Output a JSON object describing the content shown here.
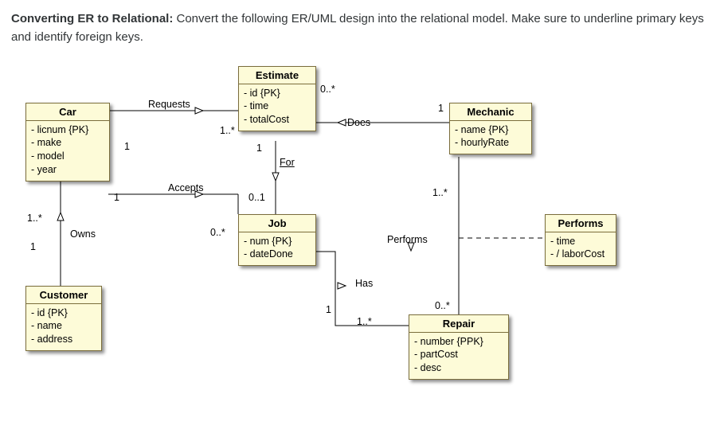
{
  "intro": {
    "lead": "Converting ER to Relational:",
    "rest": " Convert the following ER/UML design into the relational model. Make sure to underline primary keys and identify foreign keys."
  },
  "entities": {
    "car": {
      "title": "Car",
      "attrs": [
        "- licnum {PK}",
        "- make",
        "- model",
        "- year"
      ]
    },
    "estimate": {
      "title": "Estimate",
      "attrs": [
        "- id {PK}",
        "- time",
        "- totalCost"
      ]
    },
    "mechanic": {
      "title": "Mechanic",
      "attrs": [
        "- name {PK}",
        "- hourlyRate"
      ]
    },
    "job": {
      "title": "Job",
      "attrs": [
        "- num {PK}",
        "- dateDone"
      ]
    },
    "customer": {
      "title": "Customer",
      "attrs": [
        "- id {PK}",
        "- name",
        "- address"
      ]
    },
    "repair": {
      "title": "Repair",
      "attrs": [
        "- number {PPK}",
        "- partCost",
        "- desc"
      ]
    },
    "performs": {
      "title": "Performs",
      "attrs": [
        "- time",
        "- / laborCost"
      ]
    }
  },
  "labels": {
    "requests": "Requests",
    "does": "Does",
    "accepts": "Accepts",
    "for": "For",
    "owns": "Owns",
    "has": "Has",
    "performs": "Performs"
  },
  "mult": {
    "car_requests": "1..*",
    "est_requests": "1",
    "est_does": "0..*",
    "mech_does": "1",
    "car_accepts": "1",
    "job_accepts": "0..1",
    "est_for": "1",
    "job_for": "0..*",
    "car_owns": "1..*",
    "cust_owns": "1",
    "job_has": "1",
    "repair_has": "1..*",
    "mech_performs": "1..*",
    "repair_performs": "0..*"
  },
  "chart_data": {
    "type": "table",
    "description": "UML class diagram for ER-to-Relational exercise",
    "classes": [
      {
        "name": "Car",
        "attributes": [
          "licnum {PK}",
          "make",
          "model",
          "year"
        ]
      },
      {
        "name": "Estimate",
        "attributes": [
          "id {PK}",
          "time",
          "totalCost"
        ]
      },
      {
        "name": "Mechanic",
        "attributes": [
          "name {PK}",
          "hourlyRate"
        ]
      },
      {
        "name": "Job",
        "attributes": [
          "num {PK}",
          "dateDone"
        ]
      },
      {
        "name": "Customer",
        "attributes": [
          "id {PK}",
          "name",
          "address"
        ]
      },
      {
        "name": "Repair",
        "attributes": [
          "number {PPK}",
          "partCost",
          "desc"
        ]
      }
    ],
    "association_classes": [
      {
        "name": "Performs",
        "between": [
          "Mechanic",
          "Repair"
        ],
        "attributes": [
          "time",
          "/ laborCost"
        ]
      }
    ],
    "associations": [
      {
        "name": "Requests",
        "ends": [
          {
            "class": "Car",
            "mult": "1..*"
          },
          {
            "class": "Estimate",
            "mult": "1"
          }
        ]
      },
      {
        "name": "Does",
        "ends": [
          {
            "class": "Estimate",
            "mult": "0..*"
          },
          {
            "class": "Mechanic",
            "mult": "1"
          }
        ]
      },
      {
        "name": "For",
        "ends": [
          {
            "class": "Estimate",
            "mult": "1"
          },
          {
            "class": "Job",
            "mult": "0..*"
          }
        ]
      },
      {
        "name": "Accepts",
        "ends": [
          {
            "class": "Car",
            "mult": "1"
          },
          {
            "class": "Job",
            "mult": "0..1"
          }
        ]
      },
      {
        "name": "Owns",
        "ends": [
          {
            "class": "Car",
            "mult": "1..*"
          },
          {
            "class": "Customer",
            "mult": "1"
          }
        ]
      },
      {
        "name": "Has",
        "ends": [
          {
            "class": "Job",
            "mult": "1"
          },
          {
            "class": "Repair",
            "mult": "1..*"
          }
        ]
      },
      {
        "name": "Performs",
        "ends": [
          {
            "class": "Mechanic",
            "mult": "1..*"
          },
          {
            "class": "Repair",
            "mult": "0..*"
          }
        ]
      }
    ]
  }
}
